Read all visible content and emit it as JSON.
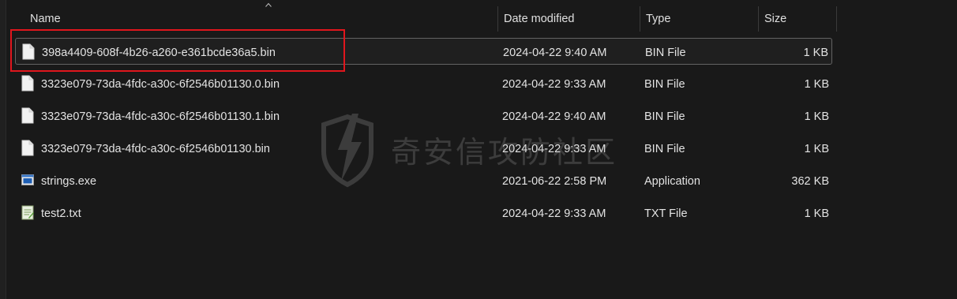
{
  "columns": {
    "name": "Name",
    "date_modified": "Date modified",
    "type": "Type",
    "size": "Size"
  },
  "files": [
    {
      "name": "398a4409-608f-4b26-a260-e361bcde36a5.bin",
      "date": "2024-04-22 9:40 AM",
      "type": "BIN File",
      "size": "1 KB",
      "icon": "document-icon",
      "selected": true
    },
    {
      "name": "3323e079-73da-4fdc-a30c-6f2546b01130.0.bin",
      "date": "2024-04-22 9:33 AM",
      "type": "BIN File",
      "size": "1 KB",
      "icon": "document-icon"
    },
    {
      "name": "3323e079-73da-4fdc-a30c-6f2546b01130.1.bin",
      "date": "2024-04-22 9:40 AM",
      "type": "BIN File",
      "size": "1 KB",
      "icon": "document-icon"
    },
    {
      "name": "3323e079-73da-4fdc-a30c-6f2546b01130.bin",
      "date": "2024-04-22 9:33 AM",
      "type": "BIN File",
      "size": "1 KB",
      "icon": "document-icon"
    },
    {
      "name": "strings.exe",
      "date": "2021-06-22 2:58 PM",
      "type": "Application",
      "size": "362 KB",
      "icon": "application-icon"
    },
    {
      "name": "test2.txt",
      "date": "2024-04-22 9:33 AM",
      "type": "TXT File",
      "size": "1 KB",
      "icon": "text-file-icon"
    }
  ],
  "watermark": {
    "text": "奇安信攻防社区"
  },
  "colors": {
    "background": "#191919",
    "highlight_border": "#e0161d",
    "selected_border": "#636363",
    "text": "#e3e3e3"
  }
}
